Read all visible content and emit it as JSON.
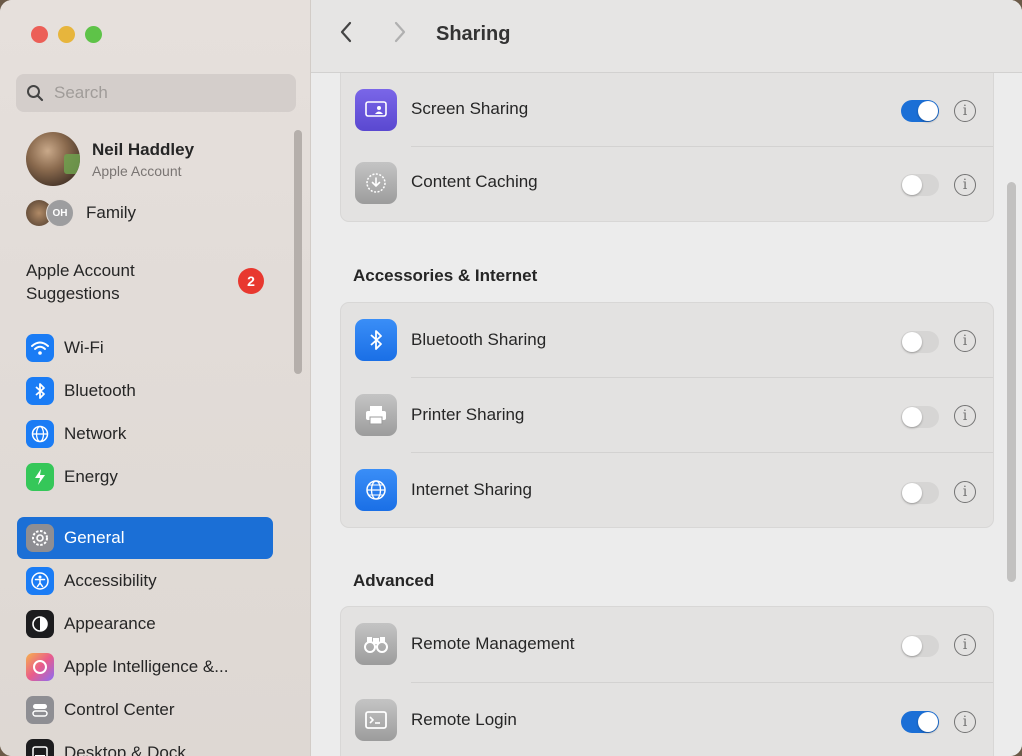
{
  "window": {
    "title": "Sharing"
  },
  "sidebar": {
    "search_placeholder": "Search",
    "profile": {
      "name": "Neil Haddley",
      "subtitle": "Apple Account"
    },
    "family": {
      "label": "Family",
      "initials": "OH"
    },
    "suggestions": {
      "label": "Apple Account Suggestions",
      "badge": "2"
    },
    "items": [
      {
        "label": "Wi-Fi",
        "icon": "wifi-icon",
        "color": "#1a7cf5"
      },
      {
        "label": "Bluetooth",
        "icon": "bluetooth-icon",
        "color": "#1a7cf5"
      },
      {
        "label": "Network",
        "icon": "globe-icon",
        "color": "#1a7cf5"
      },
      {
        "label": "Energy",
        "icon": "lightning-icon",
        "color": "#35c759"
      },
      {
        "label": "General",
        "icon": "gear-icon",
        "color": "#8e8e93",
        "active": true
      },
      {
        "label": "Accessibility",
        "icon": "accessibility-icon",
        "color": "#1a7cf5"
      },
      {
        "label": "Appearance",
        "icon": "appearance-icon",
        "color": "#1c1c1e"
      },
      {
        "label": "Apple Intelligence &...",
        "icon": "apple-intelligence-icon",
        "color": "#f08a4b"
      },
      {
        "label": "Control Center",
        "icon": "control-center-icon",
        "color": "#8e8e93"
      },
      {
        "label": "Desktop & Dock",
        "icon": "desktop-dock-icon",
        "color": "#1c1c1e"
      }
    ]
  },
  "main": {
    "top_card": [
      {
        "label": "Screen Sharing",
        "icon": "screen-sharing-icon",
        "enabled": true
      },
      {
        "label": "Content Caching",
        "icon": "content-caching-icon",
        "enabled": false
      }
    ],
    "accessories_header": "Accessories & Internet",
    "accessories": [
      {
        "label": "Bluetooth Sharing",
        "icon": "bluetooth-icon",
        "enabled": false
      },
      {
        "label": "Printer Sharing",
        "icon": "printer-icon",
        "enabled": false
      },
      {
        "label": "Internet Sharing",
        "icon": "globe-icon",
        "enabled": false
      }
    ],
    "advanced_header": "Advanced",
    "advanced": [
      {
        "label": "Remote Management",
        "icon": "binoculars-icon",
        "enabled": false
      },
      {
        "label": "Remote Login",
        "icon": "terminal-icon",
        "enabled": true
      }
    ]
  }
}
